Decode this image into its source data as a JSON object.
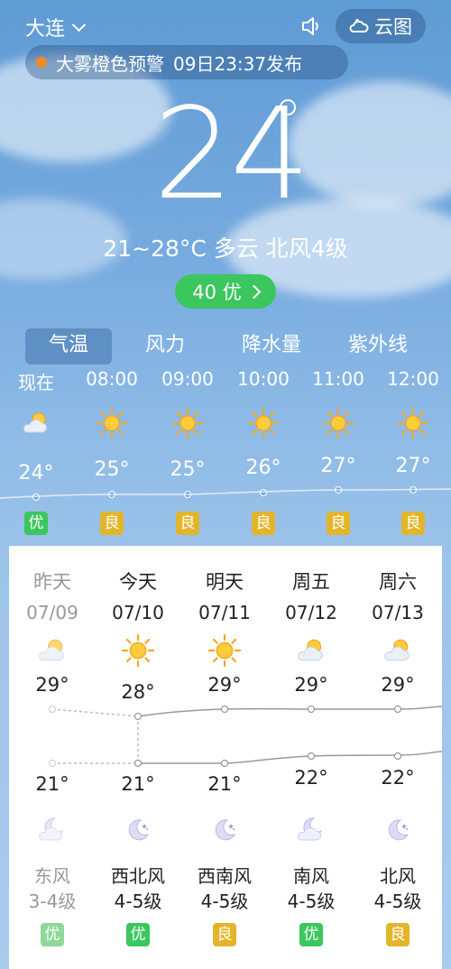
{
  "header": {
    "city": "大连",
    "cloud_map": "云图"
  },
  "alert": {
    "text": "大雾橙色预警",
    "time": "09日23:37发布",
    "color": "#f08a24"
  },
  "current": {
    "temp": "24",
    "summary": "21~28°C 多云 北风4级",
    "aqi": "40 优"
  },
  "tabs": [
    "气温",
    "风力",
    "降水量",
    "紫外线"
  ],
  "hourly": [
    {
      "time": "现在",
      "temp": "24°",
      "aqi": "优",
      "icon": "partly-cloudy-icon"
    },
    {
      "time": "08:00",
      "temp": "25°",
      "aqi": "良",
      "icon": "sun-icon"
    },
    {
      "time": "09:00",
      "temp": "25°",
      "aqi": "良",
      "icon": "sun-icon"
    },
    {
      "time": "10:00",
      "temp": "26°",
      "aqi": "良",
      "icon": "sun-icon"
    },
    {
      "time": "11:00",
      "temp": "27°",
      "aqi": "良",
      "icon": "sun-icon"
    },
    {
      "time": "12:00",
      "temp": "27°",
      "aqi": "良",
      "icon": "sun-icon"
    }
  ],
  "daily": [
    {
      "name": "昨天",
      "date": "07/09",
      "high": "29°",
      "low": "21°",
      "wind_dir": "东风",
      "wind_lvl": "3-4级",
      "aqi": "优",
      "day_icon": "partly-cloudy-icon",
      "night_icon": "cloudy-moon-icon",
      "past": true
    },
    {
      "name": "今天",
      "date": "07/10",
      "high": "28°",
      "low": "21°",
      "wind_dir": "西北风",
      "wind_lvl": "4-5级",
      "aqi": "优",
      "day_icon": "sun-icon",
      "night_icon": "moon-stars-icon",
      "past": false
    },
    {
      "name": "明天",
      "date": "07/11",
      "high": "29°",
      "low": "21°",
      "wind_dir": "西南风",
      "wind_lvl": "4-5级",
      "aqi": "良",
      "day_icon": "sun-icon",
      "night_icon": "moon-stars-icon",
      "past": false
    },
    {
      "name": "周五",
      "date": "07/12",
      "high": "29°",
      "low": "22°",
      "wind_dir": "南风",
      "wind_lvl": "4-5级",
      "aqi": "优",
      "day_icon": "partly-cloudy-icon",
      "night_icon": "cloudy-moon-icon",
      "past": false
    },
    {
      "name": "周六",
      "date": "07/13",
      "high": "29°",
      "low": "22°",
      "wind_dir": "北风",
      "wind_lvl": "4-5级",
      "aqi": "良",
      "day_icon": "partly-cloudy-icon",
      "night_icon": "moon-stars-icon",
      "past": false
    }
  ]
}
